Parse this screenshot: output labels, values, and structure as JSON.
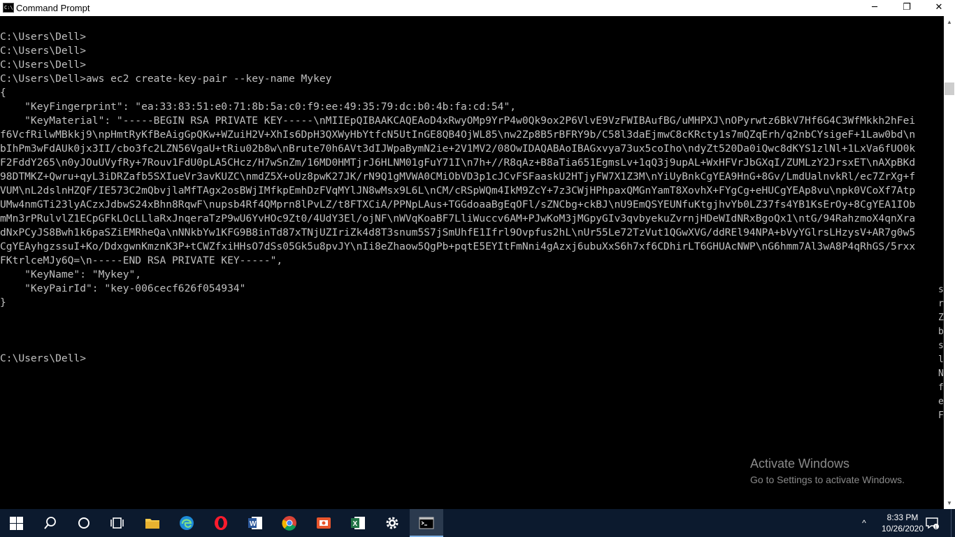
{
  "window": {
    "title": "Command Prompt",
    "icon_label": "C:\\",
    "minimize_glyph": "─",
    "maximize_glyph": "❐",
    "close_glyph": "✕"
  },
  "console": {
    "lines": [
      "C:\\Users\\Dell>",
      "C:\\Users\\Dell>",
      "C:\\Users\\Dell>",
      "C:\\Users\\Dell>aws ec2 create-key-pair --key-name Mykey",
      "{",
      "    \"KeyFingerprint\": \"ea:33:83:51:e0:71:8b:5a:c0:f9:ee:49:35:79:dc:b0:4b:fa:cd:54\",",
      "    \"KeyMaterial\": \"-----BEGIN RSA PRIVATE KEY-----\\nMIIEpQIBAAKCAQEAoD4xRwyOMp9YrP4w0Qk9ox2P6VlvE9VzFWIBAufBG/uMHPXJ\\nOPyrwtz6BkV7Hf6G4C3WfMkkh2hFei",
      "f6VcfRilwMBkkj9\\npHmtRyKfBeAigGpQKw+WZuiH2V+XhIs6DpH3QXWyHbYtfcN5UtInGE8QB4OjWL85\\nw2Zp8B5rBFRY9b/C58l3daEjmwC8cKRcty1s7mQZqErh/q2nbCYsigeF+1Law0bd\\n",
      "bIhPm3wFdAUk0jx3II/cbo3fc2LZN56VgaU+tRiu02b8w\\nBrute70h6AVt3dIJWpaBymN2ie+2V1MV2/08OwIDAQABAoIBAGxvya73ux5coIho\\ndyZt520Da0iQwc8dKYS1zlNl+1LxVa6fUO0k",
      "F2FddY265\\n0yJOuUVyfRy+7Rouv1FdU0pLA5CHcz/H7wSnZm/16MD0HMTjrJ6HLNM01gFuY71I\\n7h+//R8qAz+B8aTia651EgmsLv+1qQ3j9upAL+WxHFVrJbGXqI/ZUMLzY2JrsxET\\nAXpBKd",
      "98DTMKZ+Qwru+qyL3iDRZafb5SXIueVr3avKUZC\\nmdZ5X+oUz8pwK27JK/rN9Q1gMVWA0CMiObVD3p1cJCvFSFaaskU2HTjyFW7X1Z3M\\nYiUyBnkCgYEA9HnG+8Gv/LmdUalnvkRl/ec7ZrXg+f",
      "VUM\\nL2dslnHZQF/IE573C2mQbvjlaMfTAgx2osBWjIMfkpEmhDzFVqMYlJN8wMsx9L6L\\nCM/cRSpWQm4IkM9ZcY+7z3CWjHPhpaxQMGnYamT8XovhX+FYgCg+eHUCgYEAp8vu\\npk0VCoXf7Atp",
      "UMw4nmGTi23lyACzxJdbwS24xBhn8RqwF\\nupsb4Rf4QMprn8lPvLZ/t8FTXCiA/PPNpLAus+TGGdoaaBgEqOFl/sZNCbg+ckBJ\\nU9EmQSYEUNfuKtgjhvYb0LZ37fs4YB1KsErOy+8CgYEA1IOb",
      "mMn3rPRulvlZ1ECpGFkLOcLLlaRxJnqeraTzP9wU6YvHOc9Zt0/4UdY3El/ojNF\\nWVqKoaBF7LliWuccv6AM+PJwKoM3jMGpyGIv3qvbyekuZvrnjHDeWIdNRxBgoQx1\\ntG/94RahzmoX4qnXra",
      "dNxPCyJS8Bwh1k6paSZiEMRheQa\\nNNkbYw1KFG9B8inTd87xTNjUZIriZk4d8T3snum5S7jSmUhfE1Ifrl9Ovpfus2hL\\nUr55Le72TzVut1QGwXVG/ddREl94NPA+bVyYGlrsLHzysV+AR7g0w5",
      "CgYEAyhgzssuI+Ko/DdxgwnKmznK3P+tCWZfxiHHsO7dSs05Gk5u8pvJY\\nIi8eZhaow5QgPb+pqtE5EYItFmNni4gAzxj6ubuXxS6h7xf6CDhirLT6GHUAcNWP\\nG6hmm7Al3wA8P4qRhGS/5rxx",
      "FKtrlceMJy6Q=\\n-----END RSA PRIVATE KEY-----\",",
      "    \"KeyName\": \"Mykey\",",
      "    \"KeyPairId\": \"key-006cecf626f054934\"",
      "}",
      "",
      "",
      "",
      "C:\\Users\\Dell>"
    ],
    "side_column": [
      "s",
      "r",
      "Z",
      "b",
      "s",
      "l",
      "N",
      "f",
      "e",
      "F"
    ]
  },
  "scrollbar": {
    "up_glyph": "▲",
    "down_glyph": "▼",
    "position_fraction": 0.12
  },
  "watermark": {
    "title": "Activate Windows",
    "subtitle": "Go to Settings to activate Windows."
  },
  "taskbar": {
    "items": [
      {
        "name": "start-button",
        "icon": "windows-logo-icon"
      },
      {
        "name": "search-button",
        "icon": "search-icon"
      },
      {
        "name": "task-view-button",
        "icon": "cortana-circle-icon"
      },
      {
        "name": "task-view-2-button",
        "icon": "task-view-icon"
      },
      {
        "name": "file-explorer-button",
        "icon": "folder-icon"
      },
      {
        "name": "edge-button",
        "icon": "edge-icon"
      },
      {
        "name": "opera-button",
        "icon": "opera-icon"
      },
      {
        "name": "word-button",
        "icon": "word-icon"
      },
      {
        "name": "chrome-button",
        "icon": "chrome-icon"
      },
      {
        "name": "app-button",
        "icon": "app-icon"
      },
      {
        "name": "excel-button",
        "icon": "excel-icon"
      },
      {
        "name": "settings-button",
        "icon": "gear-icon"
      },
      {
        "name": "cmd-button",
        "icon": "cmd-icon"
      }
    ],
    "tray_chevron": "^",
    "time": "8:33 PM",
    "date": "10/26/2020"
  }
}
